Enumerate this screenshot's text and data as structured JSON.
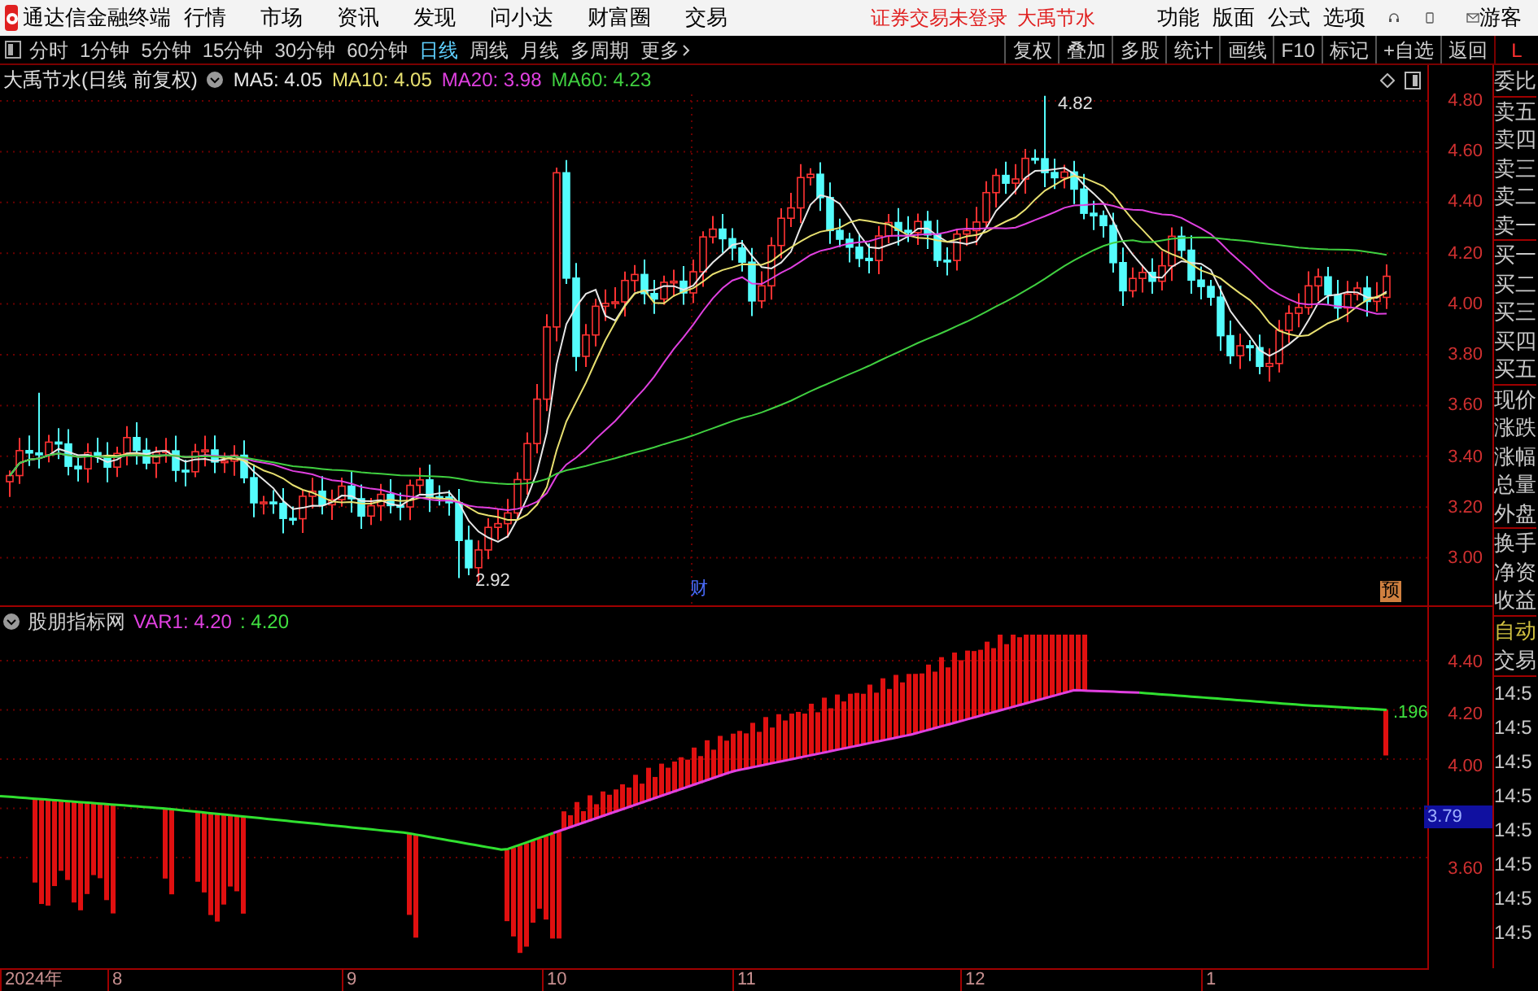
{
  "menu_bar": {
    "app_title": "通达信金融终端",
    "menus": [
      "行情",
      "市场",
      "资讯",
      "发现",
      "问小达",
      "财富圈",
      "交易"
    ],
    "status_text": "证券交易未登录",
    "stock_name": "大禹节水",
    "right_menus": [
      "功能",
      "版面",
      "公式",
      "选项"
    ],
    "user": "游客"
  },
  "toolbar": {
    "periods": [
      {
        "label": "分时",
        "selected": false
      },
      {
        "label": "1分钟",
        "selected": false
      },
      {
        "label": "5分钟",
        "selected": false
      },
      {
        "label": "15分钟",
        "selected": false
      },
      {
        "label": "30分钟",
        "selected": false
      },
      {
        "label": "60分钟",
        "selected": false
      },
      {
        "label": "日线",
        "selected": true
      },
      {
        "label": "周线",
        "selected": false
      },
      {
        "label": "月线",
        "selected": false
      },
      {
        "label": "多周期",
        "selected": false
      }
    ],
    "more": "更多",
    "buttons": [
      "复权",
      "叠加",
      "多股",
      "统计",
      "画线",
      "F10",
      "标记",
      "+自选",
      "返回"
    ],
    "corner": "L"
  },
  "main_chart": {
    "title": "大禹节水(日线 前复权)",
    "ma_legend": [
      {
        "label": "MA5: 4.05",
        "color": "#e8e8e8"
      },
      {
        "label": "MA10: 4.05",
        "color": "#e8e070"
      },
      {
        "label": "MA20: 3.98",
        "color": "#e040e0"
      },
      {
        "label": "MA60: 4.23",
        "color": "#40d040"
      }
    ],
    "y_ticks": [
      "4.80",
      "4.60",
      "4.40",
      "4.20",
      "4.00",
      "3.80",
      "3.60",
      "3.40",
      "3.20",
      "3.00"
    ],
    "high_label": "4.82",
    "low_label": "2.92",
    "markers": [
      {
        "text": "财",
        "kind": "finance"
      },
      {
        "text": "预",
        "kind": "forecast"
      }
    ]
  },
  "indicator": {
    "title": "股朋指标网",
    "legend": [
      {
        "label": "VAR1: 4.20",
        "color": "#e040e0"
      },
      {
        "label": ": 4.20",
        "color": "#40e040"
      }
    ],
    "y_ticks": [
      {
        "label": "4.40",
        "selected": false
      },
      {
        "label": "4.20",
        "selected": false
      },
      {
        "label": "4.00",
        "selected": false
      },
      {
        "label": "3.79",
        "selected": true
      },
      {
        "label": "3.60",
        "selected": false
      }
    ],
    "end_label": ".196"
  },
  "date_axis": [
    "2024年",
    "8",
    "9",
    "10",
    "11",
    "12",
    "1"
  ],
  "side_panel": {
    "quote_labels": [
      "委比",
      "卖五",
      "卖四",
      "卖三",
      "卖二",
      "卖一",
      "买一",
      "买二",
      "买三",
      "买四",
      "买五",
      "现价",
      "涨跌",
      "涨幅",
      "总量",
      "外盘",
      "换手",
      "净资",
      "收益"
    ],
    "trade_header": [
      "自动",
      "交易"
    ],
    "times": [
      "14:5",
      "14:5",
      "14:5",
      "14:5",
      "14:5",
      "14:5",
      "14:5",
      "14:5"
    ]
  }
}
